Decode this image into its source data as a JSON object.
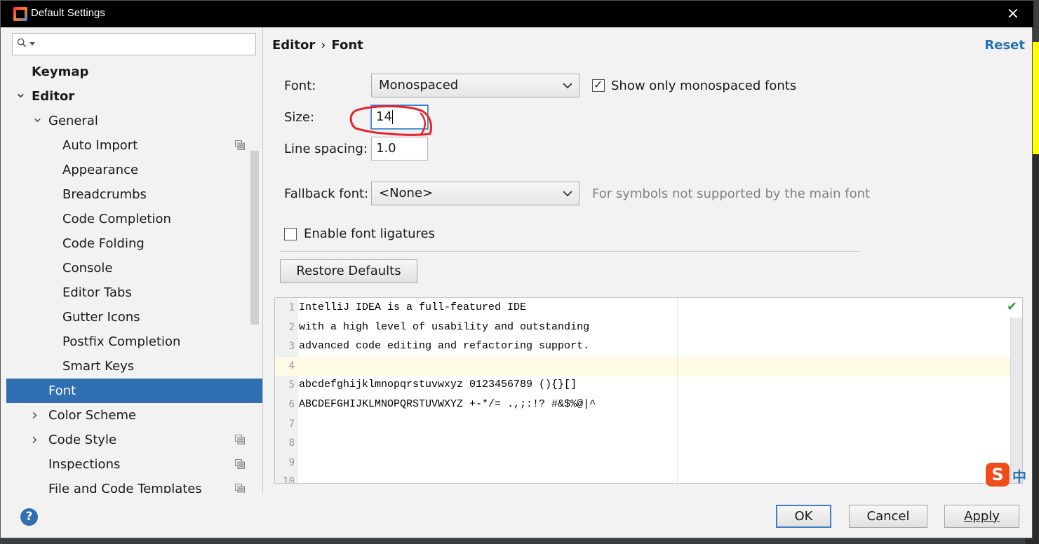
{
  "window": {
    "title": "Default Settings",
    "close_glyph": "×"
  },
  "sidebar": {
    "search_placeholder": "",
    "items": [
      {
        "label": "Keymap",
        "level": 0,
        "bold": true
      },
      {
        "label": "Editor",
        "level": 0,
        "bold": true,
        "expanded": true
      },
      {
        "label": "General",
        "level": 1,
        "expanded": true
      },
      {
        "label": "Auto Import",
        "level": 2,
        "project_icon": true
      },
      {
        "label": "Appearance",
        "level": 2
      },
      {
        "label": "Breadcrumbs",
        "level": 2
      },
      {
        "label": "Code Completion",
        "level": 2
      },
      {
        "label": "Code Folding",
        "level": 2
      },
      {
        "label": "Console",
        "level": 2
      },
      {
        "label": "Editor Tabs",
        "level": 2
      },
      {
        "label": "Gutter Icons",
        "level": 2
      },
      {
        "label": "Postfix Completion",
        "level": 2
      },
      {
        "label": "Smart Keys",
        "level": 2
      },
      {
        "label": "Font",
        "level": 1,
        "selected": true
      },
      {
        "label": "Color Scheme",
        "level": 1,
        "collapsed": true
      },
      {
        "label": "Code Style",
        "level": 1,
        "collapsed": true,
        "project_icon": true
      },
      {
        "label": "Inspections",
        "level": 1,
        "project_icon": true
      },
      {
        "label": "File and Code Templates",
        "level": 1,
        "project_icon": true
      }
    ]
  },
  "content": {
    "breadcrumb": {
      "parent": "Editor",
      "separator": "›",
      "current": "Font"
    },
    "reset_label": "Reset",
    "font_label": "Font:",
    "font_value": "Monospaced",
    "show_mono_label": "Show only monospaced fonts",
    "show_mono_checked": true,
    "size_label": "Size:",
    "size_value": "14",
    "line_spacing_label": "Line spacing:",
    "line_spacing_value": "1.0",
    "fallback_label": "Fallback font:",
    "fallback_value": "<None>",
    "fallback_hint": "For symbols not supported by the main font",
    "ligatures_label": "Enable font ligatures",
    "ligatures_checked": false,
    "restore_label": "Restore Defaults"
  },
  "preview": {
    "line_numbers": [
      "1",
      "2",
      "3",
      "4",
      "5",
      "6",
      "7",
      "8",
      "9",
      "10"
    ],
    "lines": [
      "IntelliJ IDEA is a full-featured IDE",
      "with a high level of usability and outstanding",
      "advanced code editing and refactoring support.",
      "",
      "abcdefghijklmnopqrstuvwxyz 0123456789 (){}[]",
      "ABCDEFGHIJKLMNOPQRSTUVWXYZ +-*/= .,;:!? #&$%@|^",
      "",
      "",
      "",
      ""
    ]
  },
  "footer": {
    "help": "?",
    "ok": "OK",
    "cancel": "Cancel",
    "apply": "Apply"
  },
  "ime": {
    "logo": "S",
    "mode": "中"
  },
  "colors": {
    "selection": "#2e6eb1",
    "link": "#2470b3",
    "annotation": "#e8242b",
    "caret_row": "#fefae3"
  }
}
